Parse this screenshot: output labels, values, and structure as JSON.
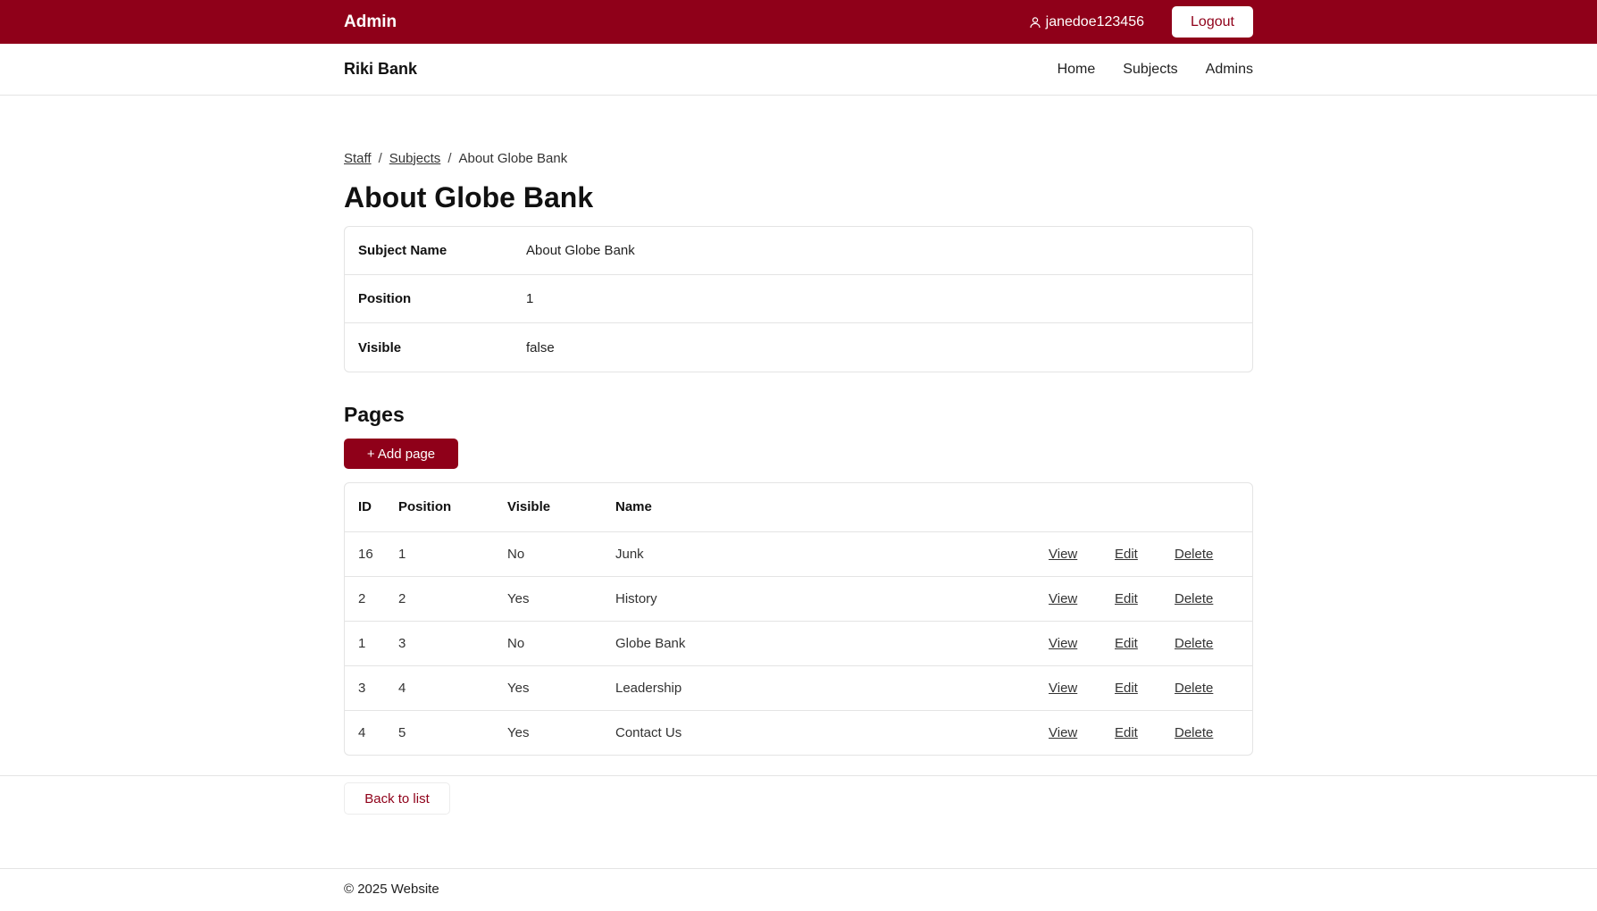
{
  "topbar": {
    "brand": "Admin",
    "username": "janedoe123456",
    "logout_label": "Logout"
  },
  "navbar": {
    "site_name": "Riki Bank",
    "links": [
      "Home",
      "Subjects",
      "Admins"
    ]
  },
  "breadcrumb": {
    "items": [
      "Staff",
      "Subjects"
    ],
    "current": "About Globe Bank",
    "separator": "/"
  },
  "page_title": "About Globe Bank",
  "details": [
    {
      "label": "Subject Name",
      "value": "About Globe Bank"
    },
    {
      "label": "Position",
      "value": "1"
    },
    {
      "label": "Visible",
      "value": "false"
    }
  ],
  "pages_section": {
    "heading": "Pages",
    "add_button_label": "+ Add page",
    "columns": [
      "ID",
      "Position",
      "Visible",
      "Name"
    ],
    "rows": [
      {
        "id": "16",
        "position": "1",
        "visible": "No",
        "name": "Junk"
      },
      {
        "id": "2",
        "position": "2",
        "visible": "Yes",
        "name": "History"
      },
      {
        "id": "1",
        "position": "3",
        "visible": "No",
        "name": "Globe Bank"
      },
      {
        "id": "3",
        "position": "4",
        "visible": "Yes",
        "name": "Leadership"
      },
      {
        "id": "4",
        "position": "5",
        "visible": "Yes",
        "name": "Contact Us"
      }
    ],
    "actions": {
      "view": "View",
      "edit": "Edit",
      "delete": "Delete"
    }
  },
  "back_button_label": "Back to list",
  "footer_text": "© 2025 Website",
  "colors": {
    "brand": "#8f0019"
  },
  "icons": {
    "user": "user-icon"
  }
}
